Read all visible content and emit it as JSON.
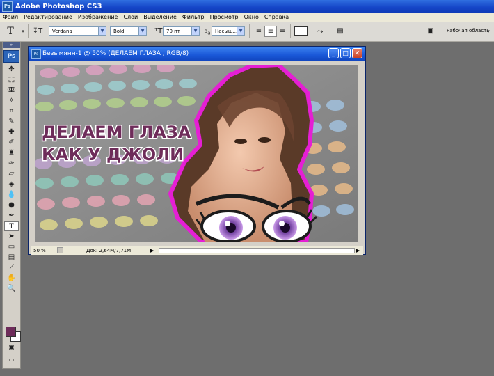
{
  "app": {
    "title": "Adobe Photoshop CS3",
    "logo": "Ps"
  },
  "menu": [
    "Файл",
    "Редактирование",
    "Изображение",
    "Слой",
    "Выделение",
    "Фильтр",
    "Просмотр",
    "Окно",
    "Справка"
  ],
  "options": {
    "font_family": "Verdana",
    "font_style": "Bold",
    "font_size": "70 пт",
    "antialias": "Насыщ...",
    "aa_label": "a",
    "aa_sub": "a",
    "workspace_label": "Рабочая область"
  },
  "document": {
    "title": "Безымянн-1 @ 50% (ДЕЛАЕМ ГЛАЗА , RGB/8)",
    "headline_line1": "ДЕЛАЕМ ГЛАЗА",
    "headline_line2": "КАК У ДЖОЛИ",
    "zoom": "50 %",
    "doc_size": "Док: 2,64M/7,71M"
  },
  "colors": {
    "accent_magenta": "#e51fd4",
    "headline": "#6e2c5a",
    "foreground": "#6e2c5a",
    "background": "#ffffff",
    "iris": "#7b4aa8"
  },
  "icons": {
    "type_tool": "type-tool-icon",
    "move_tool": "move-tool-icon"
  }
}
